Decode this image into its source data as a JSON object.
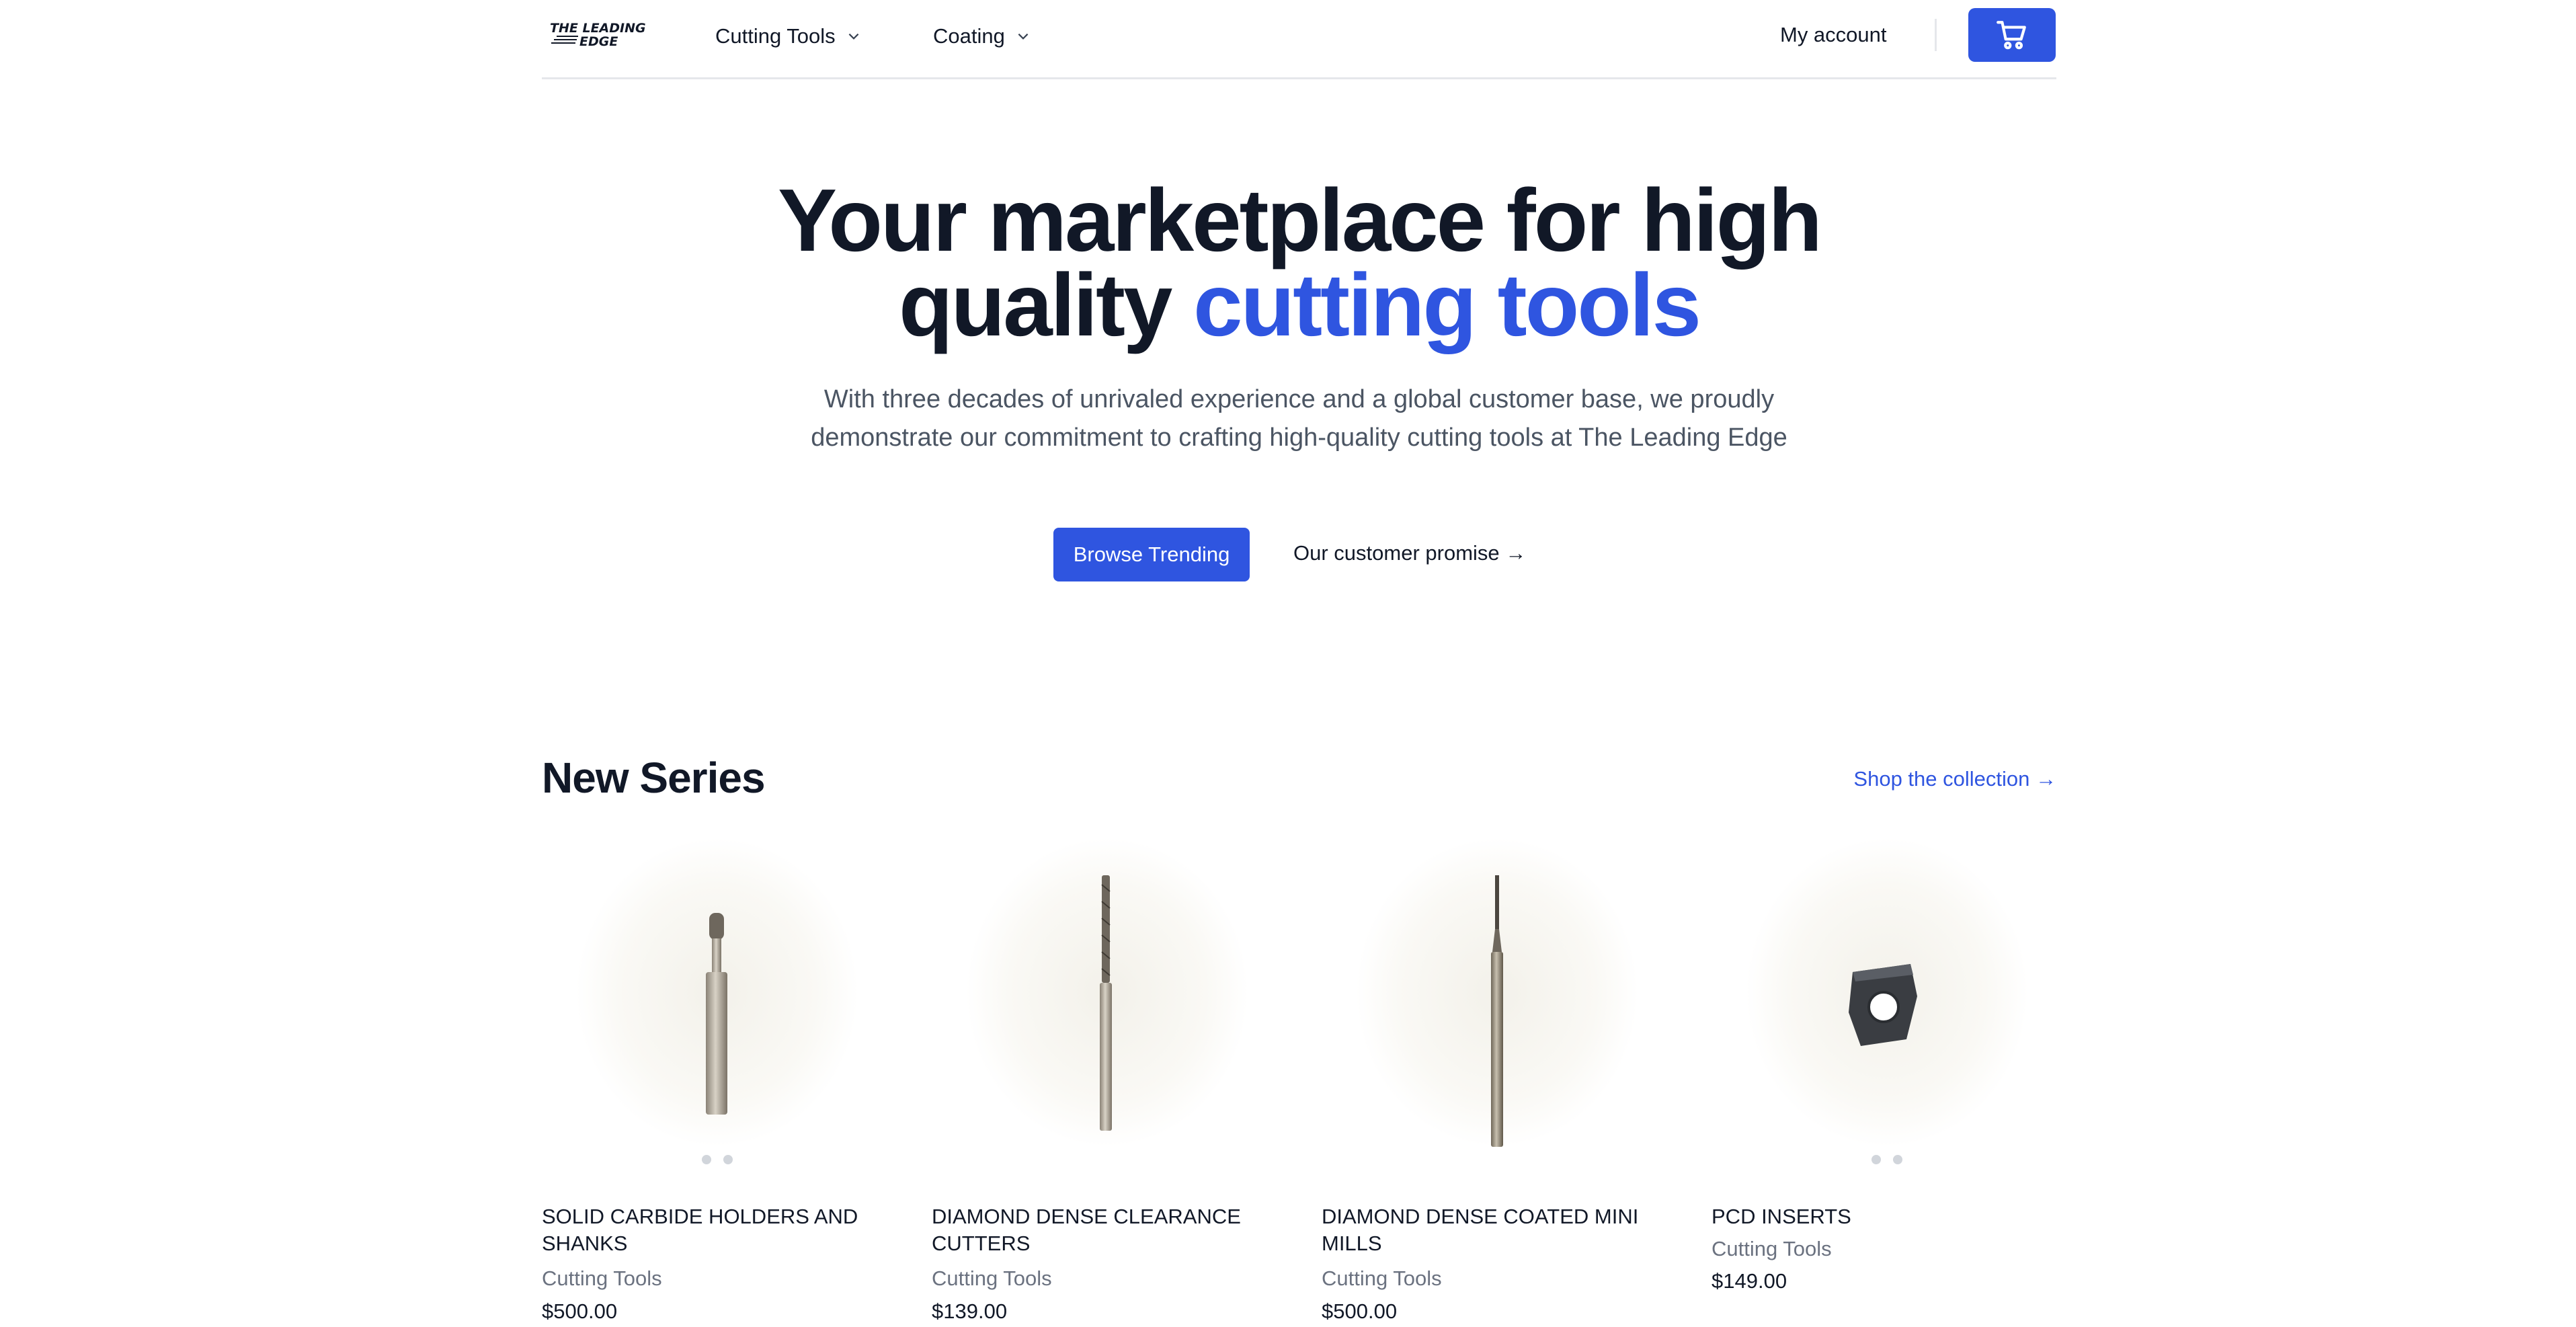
{
  "header": {
    "logo_text_1": "THE LEADING",
    "logo_text_2": "EDGE",
    "nav": [
      {
        "label": "Cutting Tools"
      },
      {
        "label": "Coating"
      }
    ],
    "account_label": "My account",
    "cart_icon": "cart-icon"
  },
  "hero": {
    "title_line1": "Your marketplace for high",
    "title_line2_plain": "quality ",
    "title_line2_accent": "cutting tools",
    "subtitle": "With three decades of unrivaled experience and a global customer base, we proudly demonstrate our commitment to crafting high-quality cutting tools at The Leading Edge",
    "primary_button": "Browse Trending",
    "secondary_link": "Our customer promise →"
  },
  "new_series": {
    "title": "New Series",
    "shop_link": "Shop the collection →",
    "products": [
      {
        "name": "SOLID CARBIDE HOLDERS AND SHANKS",
        "category": "Cutting Tools",
        "price": "$500.00",
        "image": "end-mill-short"
      },
      {
        "name": "DIAMOND DENSE CLEARANCE CUTTERS",
        "category": "Cutting Tools",
        "price": "$139.00",
        "image": "drill-bit"
      },
      {
        "name": "DIAMOND DENSE COATED MINI MILLS",
        "category": "Cutting Tools",
        "price": "$500.00",
        "image": "mini-mill"
      },
      {
        "name": "PCD INSERTS",
        "category": "Cutting Tools",
        "price": "$149.00",
        "image": "insert"
      }
    ]
  },
  "colors": {
    "accent": "#2f55e0",
    "text": "#111827",
    "muted": "#4b5563"
  }
}
